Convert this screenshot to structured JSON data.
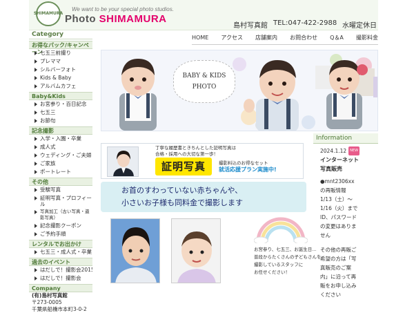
{
  "header": {
    "badge_text": "SHIMAMURA",
    "tagline": "We want to be your special photo studios.",
    "brand_prefix": "Photo ",
    "brand_accent": "SHIMAMURA",
    "studio_name": "島村写真館",
    "tel": "TEL:047-422-2988",
    "closed_day": "水曜定休日"
  },
  "topnav": [
    {
      "label": "HOME"
    },
    {
      "label": "アクセス"
    },
    {
      "label": "店舗案内"
    },
    {
      "label": "お問合わせ"
    },
    {
      "label": "Q＆A"
    },
    {
      "label": "撮影料金"
    }
  ],
  "sidebar": {
    "category_title": "Category",
    "sections": [
      {
        "title": "お得なパック/キャンペーン",
        "items": [
          "七五三前撮り",
          "プレママ",
          "シルバーフォト",
          "Kids & Baby",
          "アルバムカフェ"
        ]
      },
      {
        "title": "Baby&Kids",
        "items": [
          "お宮参り・百日記念",
          "七五三",
          "お節句"
        ]
      },
      {
        "title": "記念撮影",
        "items": [
          "入学・入園・卒業",
          "成人式",
          "ウェディング・ご夫婦",
          "ご家族",
          "ポートレート"
        ]
      },
      {
        "title": "その他",
        "items": [
          "受験写真",
          "証明写真・プロフィール",
          "写真加工（古い写真・遺影写真）",
          "記念撮影クーポン",
          "ご予約手順"
        ]
      },
      {
        "title": "レンタルでお出かけ",
        "items": [
          "七五三・成人式・卒業"
        ]
      },
      {
        "title": "過去のイベント",
        "items": [
          "はだしで！撮影会2015",
          "はだしで！撮影会"
        ]
      },
      {
        "title": "Company",
        "items": []
      }
    ],
    "company_lines": [
      "(有)島村写真館",
      "〒273-0005",
      "千葉県船橋市本町3-0-2"
    ]
  },
  "hero": {
    "line1": "BABY & KIDS",
    "line2": "PHOTO"
  },
  "cert": {
    "desc_line1": "丁寧な履歴書ときちんとした証明写真は",
    "desc_line2": "合格・採用への大切な第一歩！",
    "title": "証明写真",
    "sub1": "撮影料込のお得なセット",
    "sub2": "就活応援プラン実施中!"
  },
  "info": {
    "title": "Information",
    "date": "2024.1.12",
    "badge": "NEW",
    "heading_line1": "インターネット",
    "heading_line2": "写真販売",
    "p1": [
      "●mnt2306xx",
      "の再販情報",
      "1/13（土）～",
      "1/16（火）まで",
      "ID、パスワード",
      "の変更はありま",
      "せん"
    ],
    "p2": [
      "その他の再販ご",
      "希望の方は「写",
      "真販売のご案",
      "内」に沿って再",
      "販をお申し込み",
      "ください"
    ]
  },
  "promo": {
    "line1": "お首のすわっていない赤ちゃんや、",
    "line2": "小さいお子様も同料金で撮影します"
  },
  "bottom_text": [
    "お宮参り、七五三、お誕生日…",
    "普段からたくさんの子どもさんを",
    "撮影しているスタッフに",
    "お任せください！"
  ],
  "colors": {
    "accent_pink": "#e3006b",
    "side_green": "#4f7a38",
    "promo_bg": "#d9eff3",
    "cert_yellow": "#ffe600",
    "cert_blue": "#1a8acb"
  }
}
